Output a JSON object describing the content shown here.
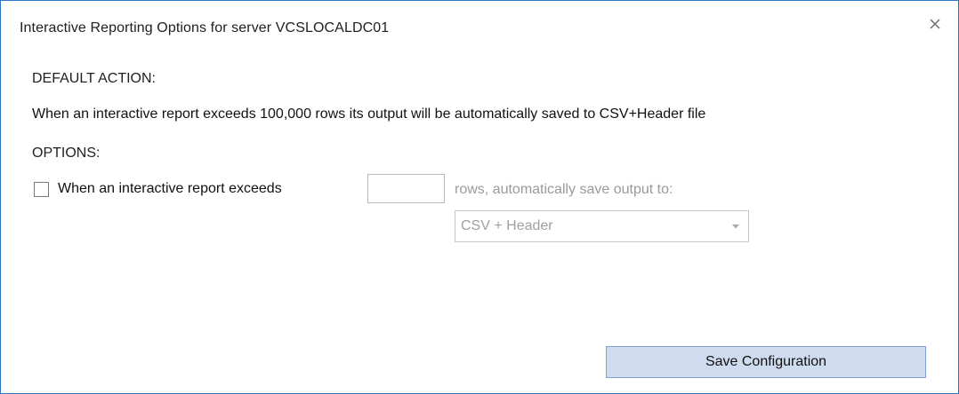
{
  "dialog": {
    "title": "Interactive Reporting Options for server VCSLOCALDC01",
    "close_icon": "close-icon"
  },
  "default_action": {
    "heading": "DEFAULT ACTION:",
    "description": "When an interactive report exceeds 100,000 rows its output will be automatically saved to CSV+Header file"
  },
  "options": {
    "heading": "OPTIONS:",
    "checkbox_checked": false,
    "checkbox_label": "When an interactive report exceeds",
    "rows_value": "",
    "save_to_label": "rows, automatically save output to:",
    "format_selected": "CSV + Header",
    "dropdown_icon": "chevron-down-icon"
  },
  "footer": {
    "save_label": "Save Configuration"
  }
}
